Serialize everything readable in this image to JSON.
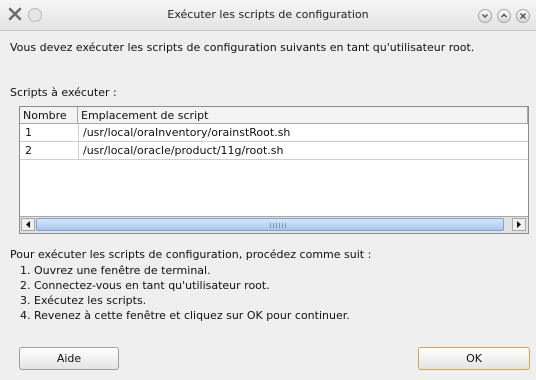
{
  "window": {
    "title": "Exécuter les scripts de configuration"
  },
  "intro_text": "Vous devez exécuter les scripts de configuration suivants en tant qu'utilisateur root.",
  "scripts_label": "Scripts à exécuter :",
  "table": {
    "columns": [
      "Nombre",
      "Emplacement de script"
    ],
    "rows": [
      [
        "1",
        "/usr/local/oraInventory/orainstRoot.sh"
      ],
      [
        "2",
        "/usr/local/oracle/product/11g/root.sh"
      ]
    ]
  },
  "instructions": {
    "heading": "Pour exécuter les scripts de configuration, procédez comme suit :",
    "steps": [
      "1. Ouvrez une fenêtre de terminal.",
      "2. Connectez-vous en tant qu'utilisateur root.",
      "3. Exécutez les scripts.",
      "4. Revenez à cette fenêtre et cliquez sur OK pour continuer."
    ]
  },
  "buttons": {
    "help": "Aide",
    "ok": "OK"
  }
}
